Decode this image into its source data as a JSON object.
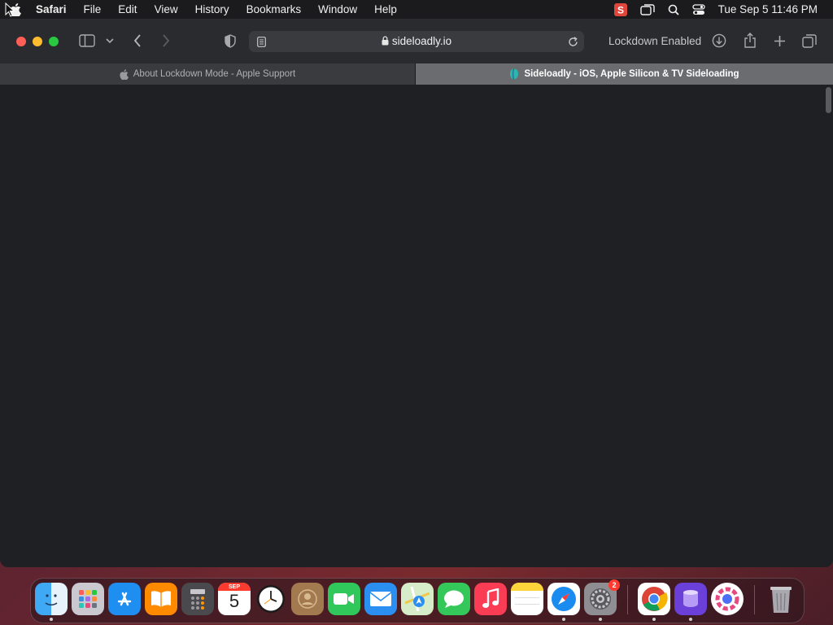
{
  "menubar": {
    "app": "Safari",
    "items": [
      "File",
      "Edit",
      "View",
      "History",
      "Bookmarks",
      "Window",
      "Help"
    ],
    "clock": "Tue Sep 5  11:46 PM"
  },
  "toolbar": {
    "url": "sideloadly.io",
    "lockdown_label": "Lockdown Enabled"
  },
  "tabs": [
    {
      "title": "About Lockdown Mode - Apple Support",
      "active": false
    },
    {
      "title": "Sideloadly - iOS, Apple Silicon & TV Sideloading",
      "active": true
    }
  ],
  "dock": {
    "apps": [
      "Finder",
      "Launchpad",
      "App Store",
      "Books",
      "Calculator",
      "Calendar",
      "Clock",
      "Contacts",
      "FaceTime",
      "Mail",
      "Maps",
      "Messages",
      "Music",
      "Notes",
      "Safari",
      "System Settings",
      "Chrome",
      "Sideloadly",
      "Sideloadly Daemon",
      "Trash"
    ],
    "calendar_month": "SEP",
    "calendar_day": "5",
    "settings_badge": "2"
  }
}
